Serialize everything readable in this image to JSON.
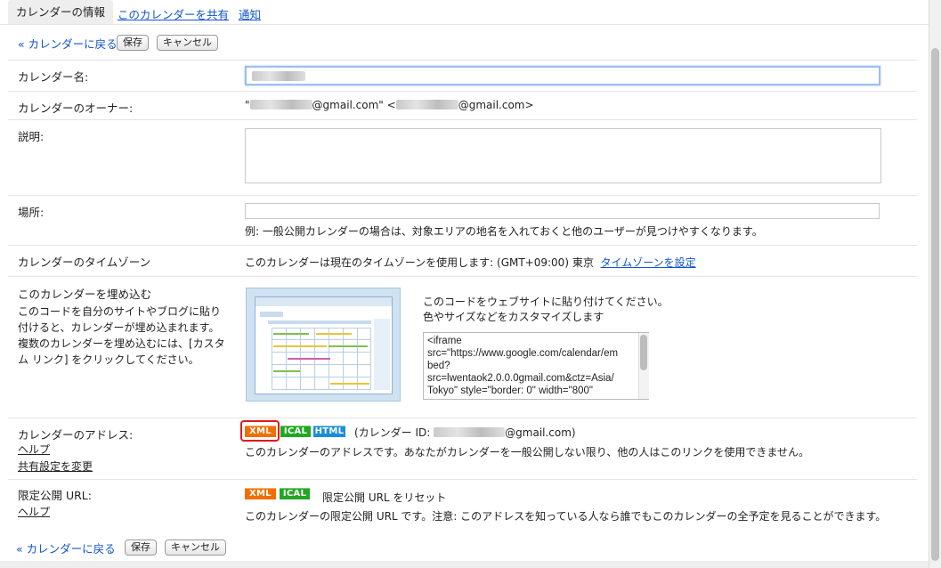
{
  "tabs": {
    "info": "カレンダーの情報",
    "share": "このカレンダーを共有",
    "notify": "通知"
  },
  "actions": {
    "back": "« カレンダーに戻る",
    "save": "保存",
    "cancel": "キャンセル"
  },
  "name": {
    "label": "カレンダー名:"
  },
  "owner": {
    "label": "カレンダーのオーナー:",
    "part1": "\"",
    "part2": "@gmail.com\" <",
    "part3": "@gmail.com>"
  },
  "description": {
    "label": "説明:"
  },
  "location": {
    "label": "場所:",
    "hint": "例: 一般公開カレンダーの場合は、対象エリアの地名を入れておくと他のユーザーが見つけやすくなります。"
  },
  "timezone": {
    "label": "カレンダーのタイムゾーン",
    "text": "このカレンダーは現在のタイムゾーンを使用します: (GMT+09:00) 東京",
    "link": "タイムゾーンを設定"
  },
  "embed": {
    "label": "このカレンダーを埋め込む",
    "desc_lines": [
      "このコードを自分のサイトやブログに貼り",
      "付けると、カレンダーが埋め込まれます。",
      "複数のカレンダーを埋め込むには、[カスタ",
      "ム リンク] をクリックしてください。"
    ],
    "instruction": "このコードをウェブサイトに貼り付けてください。",
    "customize": "色やサイズなどをカスタマイズします",
    "code": "<iframe\nsrc=\"https://www.google.com/calendar/em\nbed?\nsrc=lwentaok2.0.0.0gmail.com&ctz=Asia/\nTokyo\" style=\"border: 0\" width=\"800\""
  },
  "address": {
    "label": "カレンダーのアドレス:",
    "help": "ヘルプ",
    "change_share": "共有設定を変更",
    "xml": "XML",
    "ical": "ICAL",
    "html": "HTML",
    "id_prefix": "(カレンダー ID:",
    "id_suffix": "@gmail.com)",
    "desc": "このカレンダーのアドレスです。あなたがカレンダーを一般公開しない限り、他の人はこのリンクを使用できません。"
  },
  "private": {
    "label": "限定公開 URL:",
    "help": "ヘルプ",
    "xml": "XML",
    "ical": "ICAL",
    "reset": "限定公開 URL をリセット",
    "desc": "このカレンダーの限定公開 URL です。注意: このアドレスを知っている人なら誰でもこのカレンダーの全予定を見ることができます。"
  },
  "colors": {
    "link": "#1155cc",
    "xml_badge": "#f26e00",
    "ical_badge": "#22a722",
    "html_badge": "#1a8ed8",
    "highlight": "#e0191e"
  }
}
